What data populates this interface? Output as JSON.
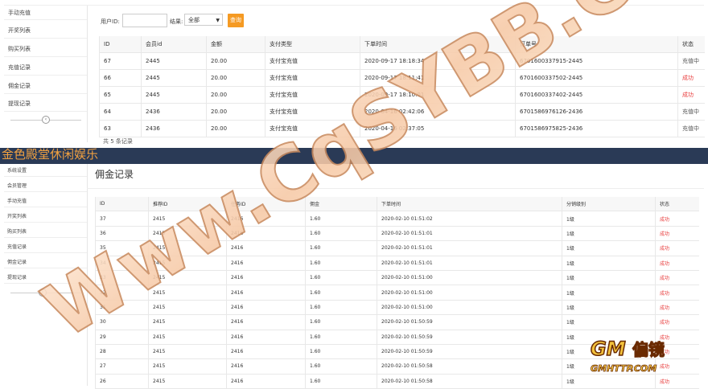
{
  "top": {
    "sidebar": {
      "items": [
        "手动充值",
        "开奖列表",
        "购买列表",
        "充值记录",
        "佣金记录",
        "提现记录"
      ]
    },
    "filter": {
      "user_id_label": "用户ID:",
      "user_id_value": "",
      "result_label": "结果:",
      "result_value": "全部",
      "query_button": "查询"
    },
    "table": {
      "headers": [
        "ID",
        "会员id",
        "金额",
        "支付类型",
        "下单时间",
        "订单号",
        "状态"
      ],
      "rows": [
        [
          "67",
          "2445",
          "20.00",
          "支付宝充值",
          "2020-09-17 18:18:34",
          "6701600337915-2445",
          "充值中",
          "pend"
        ],
        [
          "66",
          "2445",
          "20.00",
          "支付宝充值",
          "2020-09-17 18:11:41",
          "6701600337502-2445",
          "成功",
          "ok"
        ],
        [
          "65",
          "2445",
          "20.00",
          "支付宝充值",
          "2020-09-17 18:10:01",
          "6701600337402-2445",
          "成功",
          "ok"
        ],
        [
          "64",
          "2436",
          "20.00",
          "支付宝充值",
          "2020-04-16 02:42:06",
          "6701586976126-2436",
          "充值中",
          "pend"
        ],
        [
          "63",
          "2436",
          "20.00",
          "支付宝充值",
          "2020-04-16 02:37:05",
          "6701586975825-2436",
          "充值中",
          "pend"
        ]
      ]
    },
    "footer": "共 5 条记录"
  },
  "bar": {
    "title": "金色殿堂休闲娱乐"
  },
  "bottom": {
    "sidebar": {
      "items": [
        "系统设置",
        "会员管理",
        "手动充值",
        "开奖列表",
        "购买列表",
        "充值记录",
        "佣金记录",
        "提现记录"
      ]
    },
    "page_title": "佣金记录",
    "table": {
      "headers": [
        "ID",
        "推荐ID",
        "任务ID",
        "佣金",
        "下单时间",
        "分销级别",
        "状态"
      ],
      "rows": [
        [
          "37",
          "2415",
          "2416",
          "1.60",
          "2020-02-10 01:51:02",
          "1级",
          "成功"
        ],
        [
          "36",
          "2415",
          "2416",
          "1.60",
          "2020-02-10 01:51:01",
          "1级",
          "成功"
        ],
        [
          "35",
          "2415",
          "2416",
          "1.60",
          "2020-02-10 01:51:01",
          "1级",
          "成功"
        ],
        [
          "34",
          "2415",
          "2416",
          "1.60",
          "2020-02-10 01:51:01",
          "1级",
          "成功"
        ],
        [
          "33",
          "2415",
          "2416",
          "1.60",
          "2020-02-10 01:51:00",
          "1级",
          "成功"
        ],
        [
          "32",
          "2415",
          "2416",
          "1.60",
          "2020-02-10 01:51:00",
          "1级",
          "成功"
        ],
        [
          "31",
          "2415",
          "2416",
          "1.60",
          "2020-02-10 01:51:00",
          "1级",
          "成功"
        ],
        [
          "30",
          "2415",
          "2416",
          "1.60",
          "2020-02-10 01:50:59",
          "1级",
          "成功"
        ],
        [
          "29",
          "2415",
          "2416",
          "1.60",
          "2020-02-10 01:50:59",
          "1级",
          "成功"
        ],
        [
          "28",
          "2415",
          "2416",
          "1.60",
          "2020-02-10 01:50:59",
          "1级",
          "成功"
        ],
        [
          "27",
          "2415",
          "2416",
          "1.60",
          "2020-02-10 01:50:58",
          "1级",
          "成功"
        ],
        [
          "26",
          "2415",
          "2416",
          "1.60",
          "2020-02-10 01:50:58",
          "1级",
          "成功"
        ]
      ]
    }
  },
  "watermark": {
    "text": "Www.CqSYBB.Com",
    "logo_main": "GM",
    "logo_chinese": "偏镜",
    "logo_sub": "GMHTTP.COM"
  },
  "colors": {
    "accent_button": "#f59a23",
    "status_success": "#e83b3b",
    "header_bar": "#2a3a56",
    "header_title": "#f0a040"
  },
  "icons": {
    "collapse": "chevron-left-icon"
  }
}
